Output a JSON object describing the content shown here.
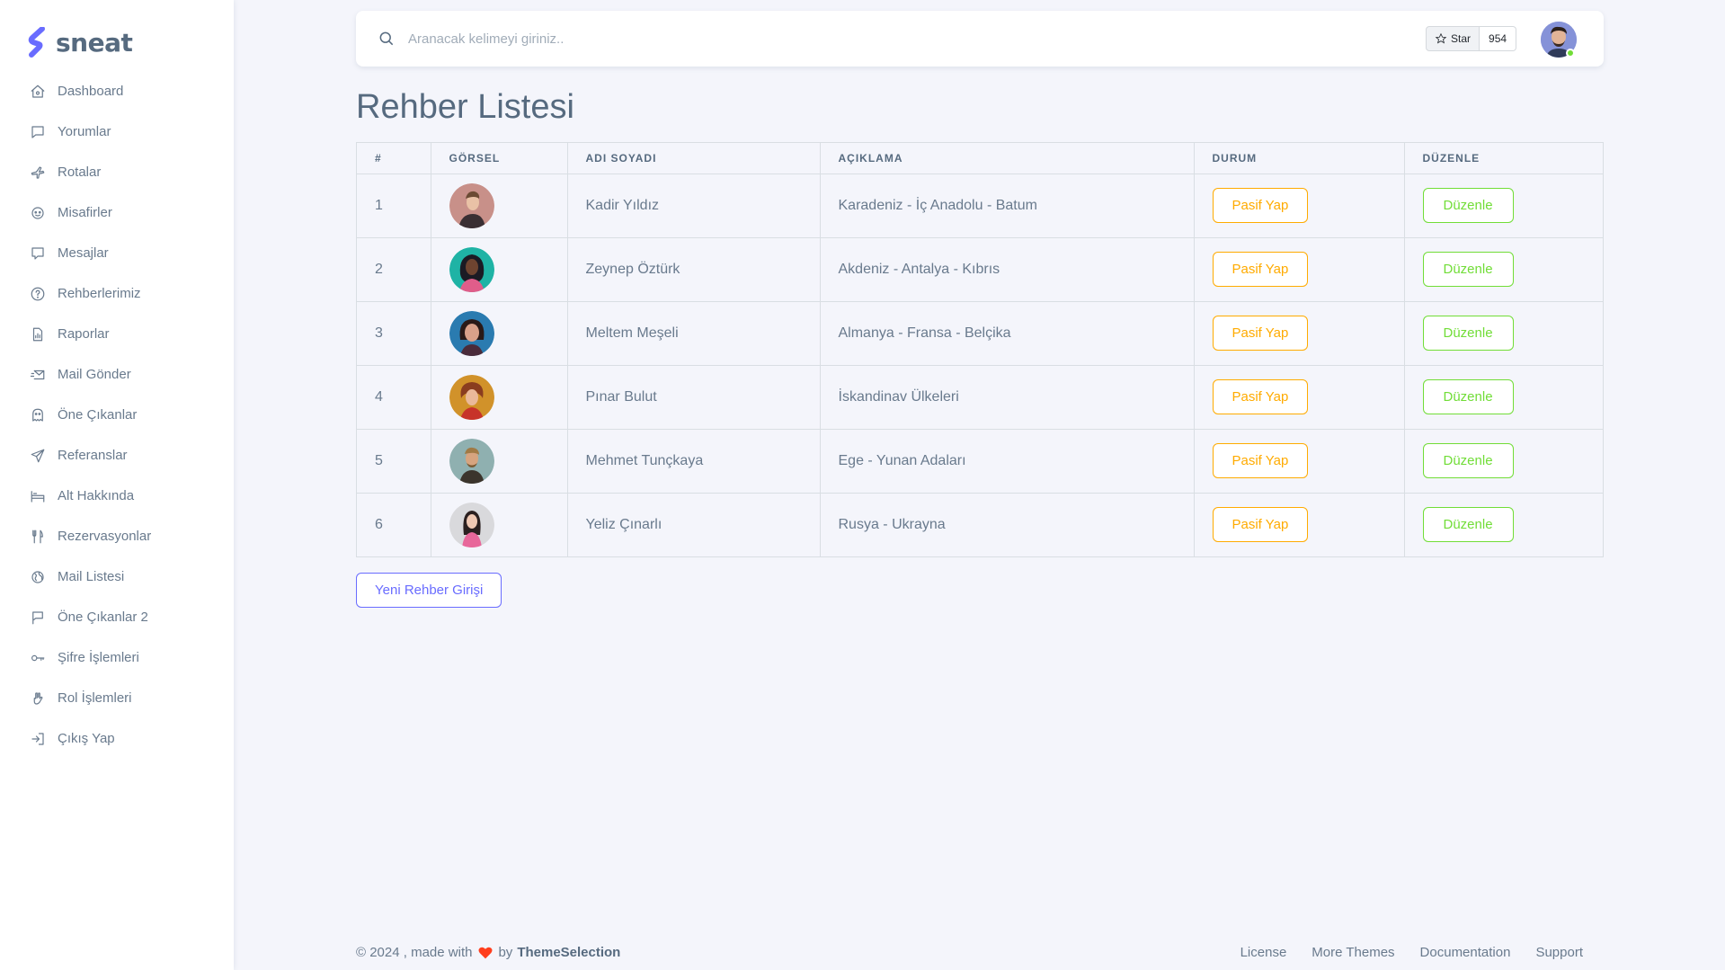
{
  "brand": {
    "name": "sneat",
    "accent": "#696cff"
  },
  "sidebar": {
    "items": [
      {
        "label": "Dashboard",
        "icon": "home-icon"
      },
      {
        "label": "Yorumlar",
        "icon": "message-square-icon"
      },
      {
        "label": "Rotalar",
        "icon": "plane-icon"
      },
      {
        "label": "Misafirler",
        "icon": "face-icon"
      },
      {
        "label": "Mesajlar",
        "icon": "message-icon"
      },
      {
        "label": "Rehberlerimiz",
        "icon": "help-circle-icon"
      },
      {
        "label": "Raporlar",
        "icon": "report-icon"
      },
      {
        "label": "Mail Gönder",
        "icon": "mail-send-icon"
      },
      {
        "label": "Öne Çıkanlar",
        "icon": "ghost-icon"
      },
      {
        "label": "Referanslar",
        "icon": "send-icon"
      },
      {
        "label": "Alt Hakkında",
        "icon": "hotel-icon"
      },
      {
        "label": "Rezervasyonlar",
        "icon": "restaurant-icon"
      },
      {
        "label": "Mail Listesi",
        "icon": "world-icon"
      },
      {
        "label": "Öne Çıkanlar 2",
        "icon": "flag-icon"
      },
      {
        "label": "Şifre İşlemleri",
        "icon": "key-icon"
      },
      {
        "label": "Rol İşlemleri",
        "icon": "hand-icon"
      },
      {
        "label": "Çıkış Yap",
        "icon": "logout-icon"
      }
    ]
  },
  "navbar": {
    "search_placeholder": "Aranacak kelimeyi giriniz..",
    "star_label": "Star",
    "star_count": "954"
  },
  "page": {
    "title": "Rehber Listesi"
  },
  "table": {
    "headers": [
      "#",
      "GÖRSEL",
      "ADI SOYADI",
      "AÇIKLAMA",
      "DURUM",
      "DÜZENLE"
    ],
    "rows": [
      {
        "num": "1",
        "name": "Kadir Yıldız",
        "desc": "Karadeniz - İç Anadolu - Batum",
        "status_btn": "Pasif Yap",
        "edit_btn": "Düzenle",
        "avatar_bg": "#c89089"
      },
      {
        "num": "2",
        "name": "Zeynep Öztürk",
        "desc": "Akdeniz - Antalya - Kıbrıs",
        "status_btn": "Pasif Yap",
        "edit_btn": "Düzenle",
        "avatar_bg": "#1fb3a5"
      },
      {
        "num": "3",
        "name": "Meltem Meşeli",
        "desc": "Almanya - Fransa - Belçika",
        "status_btn": "Pasif Yap",
        "edit_btn": "Düzenle",
        "avatar_bg": "#2a7bb0"
      },
      {
        "num": "4",
        "name": "Pınar Bulut",
        "desc": "İskandinav Ülkeleri",
        "status_btn": "Pasif Yap",
        "edit_btn": "Düzenle",
        "avatar_bg": "#d1922a"
      },
      {
        "num": "5",
        "name": "Mehmet Tunçkaya",
        "desc": "Ege - Yunan Adaları",
        "status_btn": "Pasif Yap",
        "edit_btn": "Düzenle",
        "avatar_bg": "#8fb0b0"
      },
      {
        "num": "6",
        "name": "Yeliz Çınarlı",
        "desc": "Rusya - Ukrayna",
        "status_btn": "Pasif Yap",
        "edit_btn": "Düzenle",
        "avatar_bg": "#d9d9dc"
      }
    ]
  },
  "actions": {
    "new_guide": "Yeni Rehber Girişi"
  },
  "footer": {
    "prefix": "© 2024 , made with",
    "by": "by",
    "brand": "ThemeSelection",
    "links": [
      "License",
      "More Themes",
      "Documentation",
      "Support"
    ]
  }
}
